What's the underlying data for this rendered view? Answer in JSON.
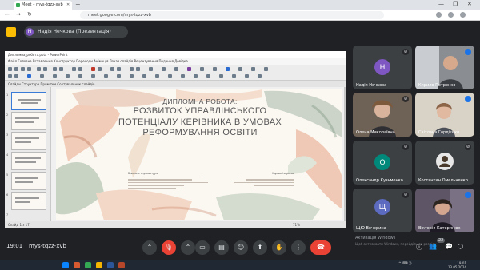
{
  "browser": {
    "tab_title": "Meet – mys-tqzz-xvb",
    "url": "meet.google.com/mys-tqzz-xvb"
  },
  "meet": {
    "presenter_label": "Надія Нечкова (Презентація)",
    "presenter_initial": "Н"
  },
  "screen": {
    "window_title": "Дипломна_робота.pptx - PowerPoint",
    "menu": "Файл   Головна   Вставлення   Конструктор   Переходи   Анімація   Показ слайдів   Рецензування   Подання   Довідка",
    "tabs": "Слайди   Структура   Примітки   Сортувальник слайдів",
    "status": "Слайд 1 з 17",
    "zoom": "71%",
    "thumb_numbers": [
      "1",
      "2",
      "3",
      "4",
      "5",
      "6",
      "7"
    ],
    "slide": {
      "title_line1": "ДИПЛОМНА РОБОТА:",
      "title_line2": "РОЗВИТОК УПРАВЛІНСЬКОГО",
      "title_line3": "ПОТЕНЦІАЛУ КЕРІВНИКА В УМОВАХ",
      "title_line4": "РЕФОРМУВАННЯ ОСВІТИ",
      "meta_left": "Виконала: слухачка групи",
      "meta_right": "Науковий керівник"
    }
  },
  "participants": [
    {
      "name": "Надія Нечкова",
      "initial": "Н",
      "color": "#7e57c2"
    },
    {
      "name": "Кирило Петренко",
      "initial": "",
      "color": "#5f6368"
    },
    {
      "name": "Олена Миколаївна",
      "initial": "",
      "color": "#6b5b4f"
    },
    {
      "name": "Світлана Гордієнко",
      "initial": "",
      "color": "#4f5b66"
    },
    {
      "name": "Олександр Кузьменко",
      "initial": "О",
      "color": "#00897b"
    },
    {
      "name": "Костянтин Омельченко",
      "initial": "",
      "color": "#5f6368"
    },
    {
      "name": "ЩЮ Вечерина",
      "initial": "Щ",
      "color": "#5c6bc0"
    },
    {
      "name": "Вікторія Катеринюк",
      "initial": "",
      "color": "#6d5a7a"
    }
  ],
  "system": {
    "activate_title": "Активація Windows",
    "activate_sub": "Щоб активувати Windows, перейдіть до розділу",
    "participant_count": "22",
    "tray_time": "19:01",
    "tray_date": "13.05.2024"
  },
  "controls": {
    "time": "19:01",
    "code": "mys-tqzz-xvb",
    "end_label": "⏷"
  }
}
